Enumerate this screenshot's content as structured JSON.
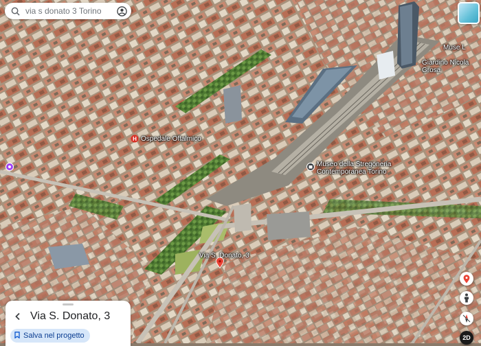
{
  "search": {
    "placeholder": "via s donato 3 Torino",
    "icon": "magnifier-icon",
    "account_icon": "account-icon"
  },
  "map": {
    "view": "3D satellite",
    "labels": {
      "hospital": "Ospedale Oftalmico",
      "museum": "Museo della Stregoneria Contemporanea Torino",
      "garden": "Giardino Nicola Grosa",
      "museum_topright": "Muse L",
      "selected_address": "Via S. Donato, 3"
    },
    "colors": {
      "hospital_pin": "#d93025",
      "museum_pin": "#3c4043",
      "selected_pin": "#ea4335",
      "left_pin": "#a142f4",
      "tree_strip": "#5f8b3a"
    }
  },
  "place_card": {
    "title": "Via S. Donato, 3",
    "save_label": "Salva nel progetto",
    "back_icon": "back-arrow-icon",
    "save_icon": "bookmark-icon"
  },
  "controls": {
    "pegman_icon": "pegman-icon",
    "compass_icon": "compass-icon",
    "view_toggle": "2D",
    "location_icon": "location-marker-icon"
  }
}
